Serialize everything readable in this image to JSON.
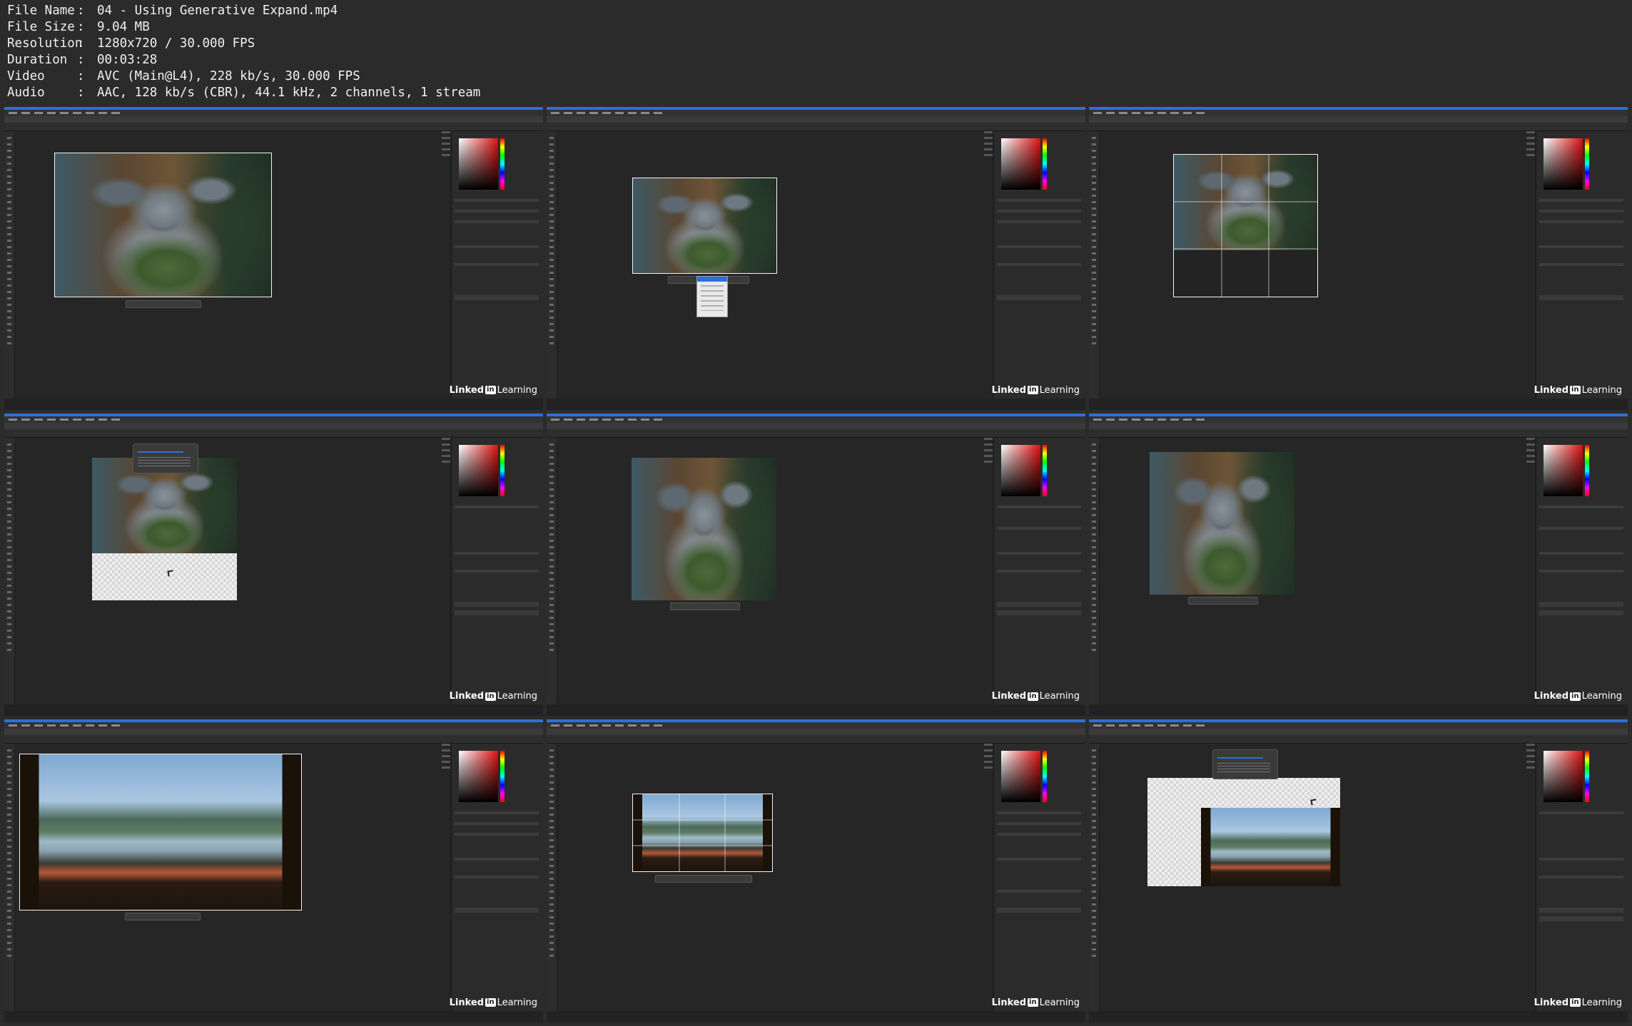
{
  "file_info": [
    {
      "key": "File Name",
      "value": "04 - Using Generative Expand.mp4"
    },
    {
      "key": "File Size",
      "value": "9.04 MB"
    },
    {
      "key": "Resolution",
      "value": "1280x720 / 30.000 FPS"
    },
    {
      "key": "Duration",
      "value": "00:03:28"
    },
    {
      "key": "Video",
      "value": "AVC (Main@L4), 228 kb/s, 30.000 FPS"
    },
    {
      "key": "Audio",
      "value": "AAC, 128 kb/s (CBR), 44.1 kHz, 2 channels, 1 stream"
    }
  ],
  "separator": ":",
  "watermark": {
    "pre": "Linked",
    "in": "in",
    "rest": " Learning"
  },
  "colors": {
    "accent": "#2f6fd6",
    "background": "#2b2b2b",
    "app_bg": "#1f1f1f"
  }
}
